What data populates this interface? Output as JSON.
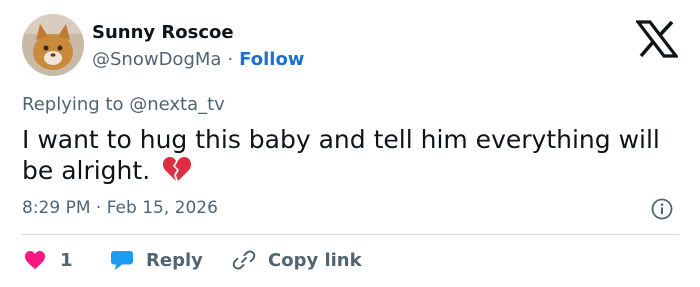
{
  "author": {
    "name": "Sunny Roscoe",
    "handle": "@SnowDogMa",
    "separator": "·",
    "follow_label": "Follow"
  },
  "reply_context": {
    "prefix": "Replying to",
    "mention": "@nexta_tv"
  },
  "tweet": {
    "text": "I want to hug this baby and tell him everything will be alright.",
    "emoji": "broken-heart"
  },
  "timestamp": "8:29 PM · Feb 15, 2026",
  "actions": {
    "like_count": "1",
    "reply_label": "Reply",
    "copy_label": "Copy link"
  },
  "colors": {
    "text": "#0f1419",
    "muted": "#536471",
    "follow": "#1d6fd0",
    "like": "#f91880",
    "reply": "#1d9bf0",
    "divider": "#cfd9de"
  },
  "icons": [
    "avatar-photo",
    "x-logo",
    "info-icon",
    "heart-icon",
    "reply-bubble-icon",
    "link-icon"
  ]
}
